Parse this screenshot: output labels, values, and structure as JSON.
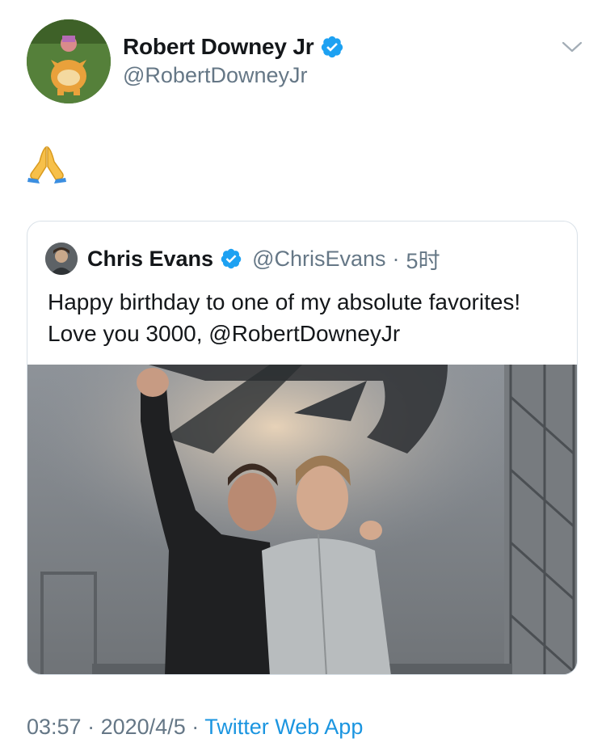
{
  "author": {
    "display_name": "Robert Downey Jr",
    "handle": "@RobertDowneyJr",
    "verified_icon": "verified-badge-icon",
    "avatar_icon": "avatar-image"
  },
  "tweet": {
    "emoji": "🙏",
    "emoji_icon": "folded-hands-emoji"
  },
  "quoted_tweet": {
    "display_name": "Chris Evans",
    "handle": "@ChrisEvans",
    "separator": "·",
    "time": "5时",
    "text": "Happy birthday to one of my absolute favorites! Love you 3000, @RobertDowneyJr",
    "media_icon": "photo-image"
  },
  "meta": {
    "time": "03:57",
    "date": "2020/4/5",
    "sep1": "·",
    "sep2": "·",
    "source": "Twitter Web App"
  },
  "colors": {
    "text": "#14171a",
    "secondary": "#657786",
    "link": "#1b95e0",
    "verified": "#1da1f2",
    "border": "#d9e1e8"
  }
}
